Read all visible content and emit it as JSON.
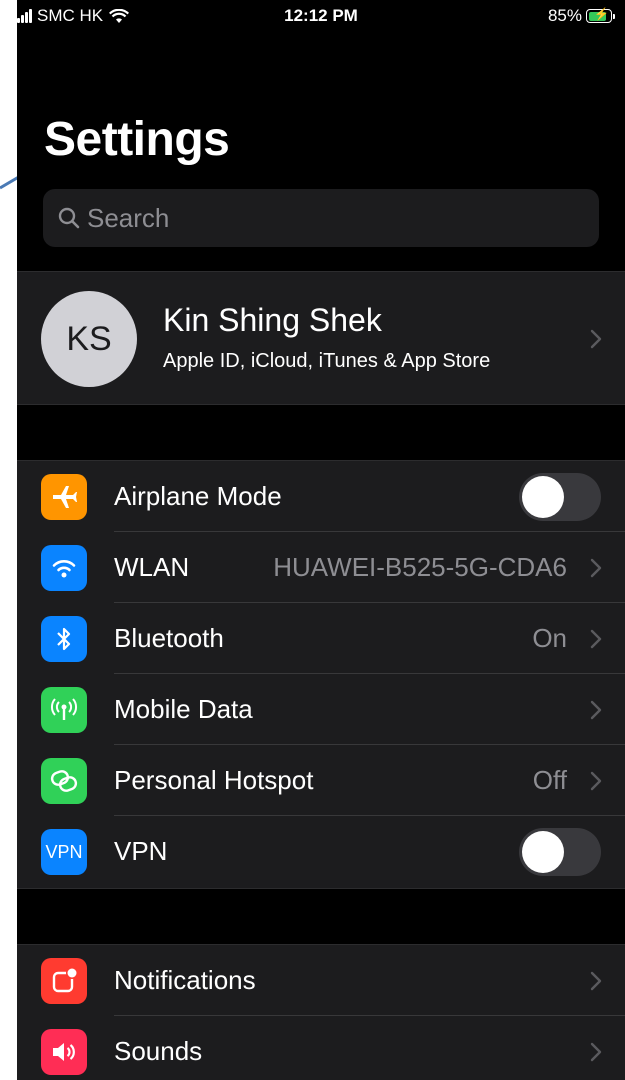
{
  "status_bar": {
    "carrier": "SMC HK",
    "time": "12:12 PM",
    "battery_percent": "85%",
    "battery_level": 0.85
  },
  "title": "Settings",
  "search": {
    "placeholder": "Search"
  },
  "profile": {
    "initials": "KS",
    "name": "Kin Shing Shek",
    "subtitle": "Apple ID, iCloud, iTunes & App Store"
  },
  "connectivity": [
    {
      "label": "Airplane Mode",
      "icon": "airplane-icon",
      "color": "#ff9500",
      "toggle": false
    },
    {
      "label": "WLAN",
      "icon": "wifi-icon",
      "color": "#0a84ff",
      "value": "HUAWEI-B525-5G-CDA6"
    },
    {
      "label": "Bluetooth",
      "icon": "bluetooth-icon",
      "color": "#0a84ff",
      "value": "On"
    },
    {
      "label": "Mobile Data",
      "icon": "antenna-icon",
      "color": "#30d158",
      "value": ""
    },
    {
      "label": "Personal Hotspot",
      "icon": "hotspot-icon",
      "color": "#30d158",
      "value": "Off"
    },
    {
      "label": "VPN",
      "icon": "vpn-icon",
      "icon_text": "VPN",
      "color": "#0a84ff",
      "toggle": false
    }
  ],
  "alerts": [
    {
      "label": "Notifications",
      "icon": "notifications-icon",
      "color": "#ff3b30"
    },
    {
      "label": "Sounds",
      "icon": "speaker-icon",
      "color": "#ff2d55"
    }
  ]
}
